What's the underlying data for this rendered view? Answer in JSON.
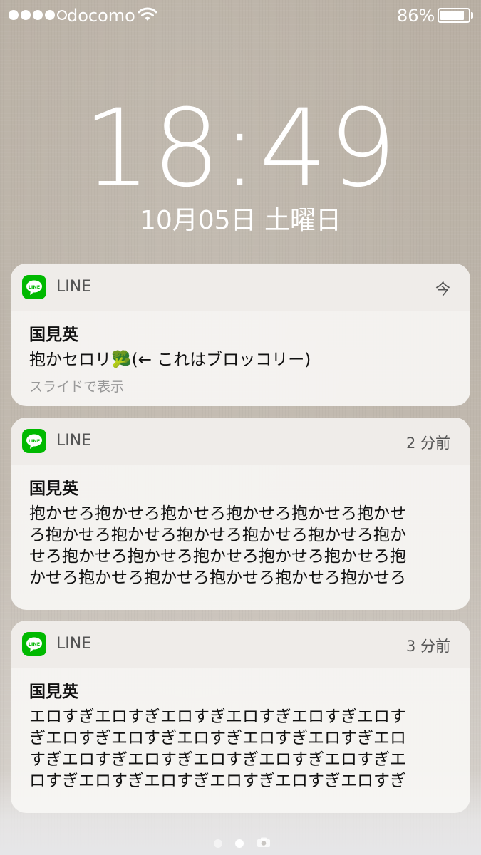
{
  "status_bar": {
    "carrier": "docomo",
    "battery_percent_text": "86%",
    "battery_level": 0.86,
    "signal_bars_filled": 4,
    "signal_bars_total": 5
  },
  "lock_screen": {
    "time": "18:49",
    "date": "10月05日 土曜日"
  },
  "notifications": [
    {
      "app": "LINE",
      "time": "今",
      "sender": "国見英",
      "message": "抱かセロリ🥦(← これはブロッコリー)",
      "hint": "スライドで表示"
    },
    {
      "app": "LINE",
      "time": "2 分前",
      "sender": "国見英",
      "message_lines": [
        "抱かせろ抱かせろ抱かせろ抱かせろ抱かせろ抱かせ",
        "ろ抱かせろ抱かせろ抱かせろ抱かせろ抱かせろ抱か",
        "せろ抱かせろ抱かせろ抱かせろ抱かせろ抱かせろ抱",
        "かせろ抱かせろ抱かせろ抱かせろ抱かせろ抱かせろ"
      ]
    },
    {
      "app": "LINE",
      "time": "3 分前",
      "sender": "国見英",
      "message_lines": [
        "エロすぎエロすぎエロすぎエロすぎエロすぎエロす",
        "ぎエロすぎエロすぎエロすぎエロすぎエロすぎエロ",
        "すぎエロすぎエロすぎエロすぎエロすぎエロすぎエ",
        "ロすぎエロすぎエロすぎエロすぎエロすぎエロすぎ"
      ]
    }
  ],
  "page_indicator": {
    "page_count": 2,
    "active_page": 2,
    "camera_icon": "camera-icon"
  },
  "colors": {
    "line_green": "#00b900",
    "text_primary": "#111111",
    "text_secondary": "#555555",
    "hint": "#999999"
  }
}
